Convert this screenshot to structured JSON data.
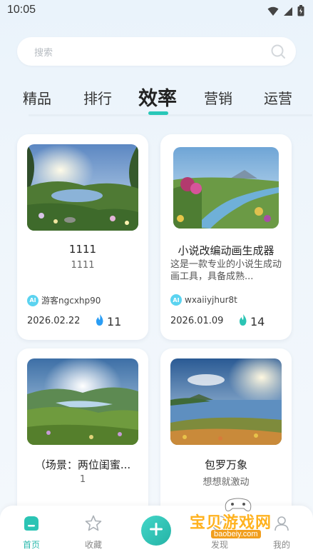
{
  "status_bar": {
    "time": "10:05"
  },
  "search": {
    "placeholder": "搜索"
  },
  "tabs": [
    {
      "label": "精品"
    },
    {
      "label": "排行"
    },
    {
      "label": "效率",
      "active": true
    },
    {
      "label": "营销"
    },
    {
      "label": "运营"
    }
  ],
  "cards": [
    {
      "title": "1111",
      "subtitle": "1111",
      "author": "游客ngcxhp90",
      "date": "2026.02.22",
      "likes": "11"
    },
    {
      "title": "小说改编动画生成器",
      "description": "这是一款专业的小说生成动画工具，具备成熟...",
      "author": "wxaiiyjhur8t",
      "date": "2026.01.09",
      "likes": "14"
    },
    {
      "title": "（场景：两位闺蜜...",
      "subtitle": "1"
    },
    {
      "title": "包罗万象",
      "subtitle": "想想就激动"
    }
  ],
  "ai_badge": "AI",
  "bottom_nav": {
    "home": "首页",
    "favorites": "收藏",
    "discover": "发现",
    "mine": "我的"
  },
  "watermark": {
    "text": "宝贝游戏网",
    "url": "baobeiy.com"
  },
  "colors": {
    "accent": "#29c7b8",
    "background": "#eef5fb"
  }
}
